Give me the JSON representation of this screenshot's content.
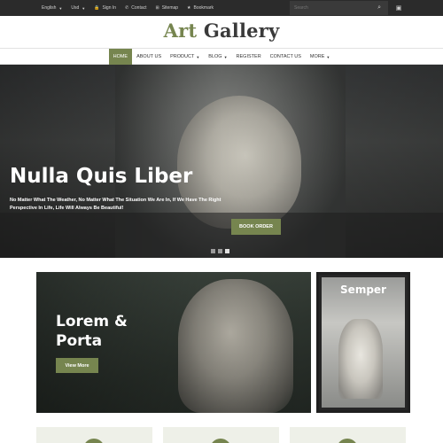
{
  "colors": {
    "accent": "#76854f",
    "topbar": "#2b2b2b",
    "text_dark": "#3a3a3a"
  },
  "topbar": {
    "language": "English",
    "currency": "Usd",
    "sign_in": "Sign In",
    "contact": "Contact",
    "sitemap": "Sitemap",
    "bookmark": "Bookmark",
    "search_placeholder": "Search"
  },
  "logo": {
    "part1": "Art",
    "part2": "Gallery"
  },
  "nav": {
    "items": [
      {
        "label": "HOME",
        "active": true
      },
      {
        "label": "ABOUT US"
      },
      {
        "label": "PRODUCT",
        "dropdown": true
      },
      {
        "label": "BLOG",
        "dropdown": true
      },
      {
        "label": "REGISTER"
      },
      {
        "label": "CONTACT US"
      },
      {
        "label": "MORE",
        "dropdown": true
      }
    ]
  },
  "hero": {
    "title": "Nulla Quis Liber",
    "text": "No Matter What The Weather, No Matter What The Situation We Are In, If We Have The Right Perspective In Life, Life Will Always Be Beautiful!",
    "button": "BOOK ORDER",
    "slides": 3,
    "active_slide": 3
  },
  "banners": [
    {
      "title": "Lorem & Porta",
      "button": "View More"
    },
    {
      "title": "Semper"
    }
  ],
  "icons": {
    "user": "user-icon",
    "contact": "phone-icon",
    "sitemap": "sitemap-icon",
    "bookmark": "bookmark-icon",
    "search": "search-icon",
    "cart": "cart-icon"
  }
}
